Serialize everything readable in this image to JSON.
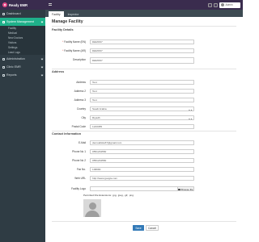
{
  "app": {
    "brand": "Ready EMR"
  },
  "topbar": {
    "user_name": "Admin"
  },
  "sidebar": {
    "items": [
      {
        "label": "Dashboard"
      },
      {
        "label": "System Management"
      }
    ],
    "subitems": [
      {
        "label": "Facility"
      },
      {
        "label": "Medical"
      },
      {
        "label": "New Doctors"
      },
      {
        "label": "Visitors"
      },
      {
        "label": "Settings"
      },
      {
        "label": "Lead Logs"
      }
    ],
    "bottom_items": [
      {
        "label": "Administration"
      },
      {
        "label": "Clinic EMR"
      },
      {
        "label": "Reports"
      }
    ]
  },
  "tabs": [
    {
      "label": "Facility"
    },
    {
      "label": "Inspector"
    }
  ],
  "main": {
    "title": "Manage Facility",
    "sections": {
      "details": "Facility Details",
      "address": "Address",
      "contact": "Contact Information"
    },
    "fields": {
      "facility_name": {
        "label": "Facility Name (EN)",
        "value": "DEMO67"
      },
      "facility_name_ar": {
        "label": "Facility Name (AR)",
        "value": "DEMO67"
      },
      "description": {
        "label": "Description",
        "value": "DEMO67"
      },
      "address1": {
        "label": "Address",
        "value": "Test"
      },
      "address2": {
        "label": "Address 2",
        "value": "Test"
      },
      "address3": {
        "label": "Address 3",
        "value": "Test"
      },
      "country": {
        "label": "Country",
        "value": "Saudi Arabia"
      },
      "city": {
        "label": "City",
        "value": "Riyadh"
      },
      "postal": {
        "label": "Postal Code",
        "value": "1243455"
      },
      "email": {
        "label": "E-Mail",
        "value": "demoallsite67@gmail.com"
      },
      "phone1": {
        "label": "Phone No 1",
        "value": "0551234550"
      },
      "phone2": {
        "label": "Phone No 2",
        "value": "0551234550"
      },
      "fax": {
        "label": "Fax No.",
        "value": "138090"
      },
      "web": {
        "label": "Web URL",
        "value": "http://www.google.com"
      },
      "logo": {
        "label": "Facility Logo",
        "value": "",
        "button": "Browse file"
      }
    },
    "logo_hint": "Permitted File Extensions: .jpg, .jpeg, .gif, .png",
    "save_label": "Save",
    "cancel_label": "Cancel"
  },
  "colors": {
    "topbar": "#3a2c4e",
    "sidebar": "#2f3c44",
    "accent": "#1fb18a",
    "primary": "#337ab7"
  }
}
